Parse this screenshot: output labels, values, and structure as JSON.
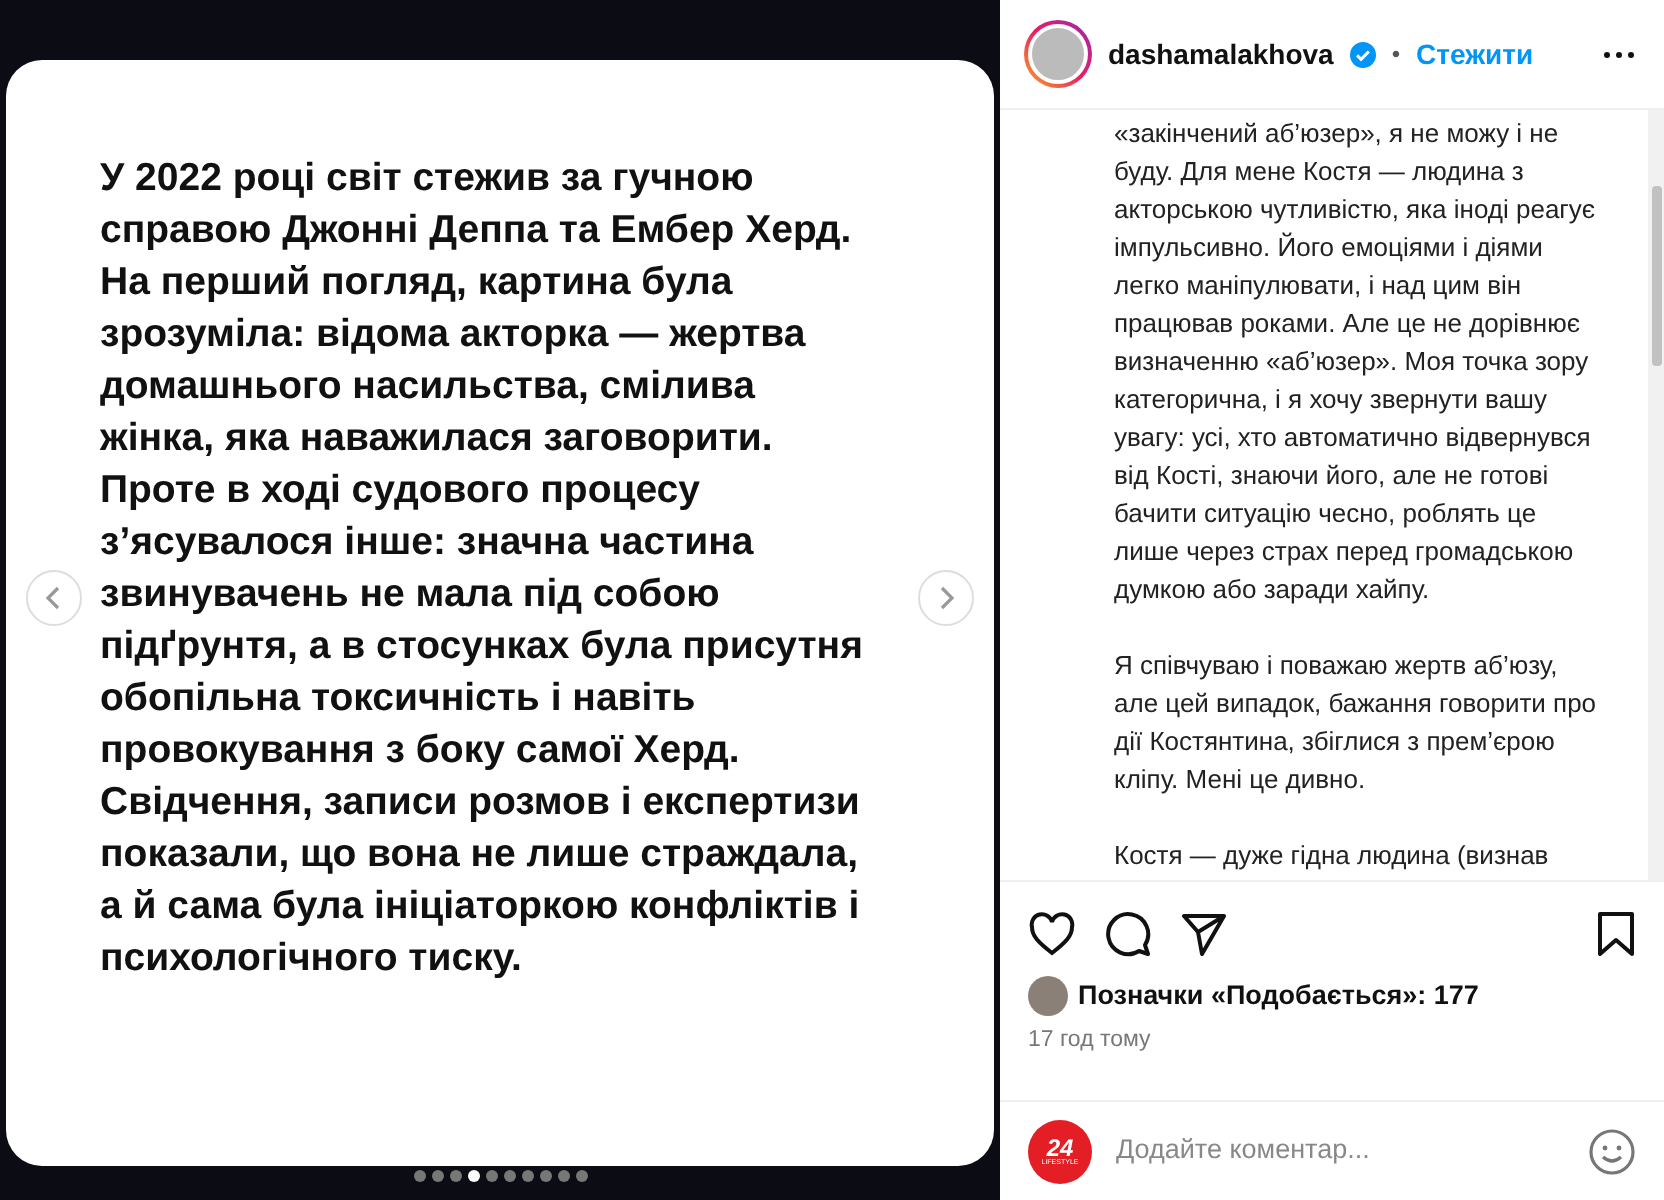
{
  "slide": {
    "text": "У 2022 році світ стежив за гучною справою Джонні Деппа та Ембер Херд. На перший погляд, картина була зрозуміла: відома акторка — жертва домашнього насильства, смілива жінка, яка наважилася заговорити. Проте в ході судового процесу з’ясувалося інше: значна частина звинувачень не мала під собою підґрунтя, а в стосунках була присутня обопільна токсичність і навіть провокування з боку самої Херд. Свідчення, записи розмов і експертизи показали, що вона не лише страждала, а й сама була ініціаторкою конфліктів і психологічного тиску."
  },
  "dots": [
    {
      "selected": false
    },
    {
      "selected": false
    },
    {
      "selected": false
    },
    {
      "selected": true
    },
    {
      "selected": false
    },
    {
      "selected": false
    },
    {
      "selected": false
    },
    {
      "selected": false
    },
    {
      "selected": false
    },
    {
      "selected": false
    }
  ],
  "header": {
    "username": "dashamalakhova",
    "verified": true,
    "separator": "•",
    "follow": "Стежити"
  },
  "caption": [
    "«закінчений аб’юзер», я не можу і не буду. Для мене Костя — людина з акторською чутливістю, яка іноді реагує імпульсивно. Його емоціями і діями легко маніпулювати, і над цим він працював роками. Але це не дорівнює визначенню «аб’юзер». Моя точка зору категорична, і я хочу звернути вашу увагу: усі, хто автоматично відвернувся від Кості, знаючи його, але не готові бачити ситуацію чесно, роблять це лише через страх перед громадською думкою або заради хайпу.",
    "Я співчуваю і поважаю жертв аб’юзу, але цей випадок, бажання говорити про дії Костянтина, збіглися з прем’єрою кліпу. Мені це дивно.",
    "Костя — дуже гідна людина (визнав"
  ],
  "likes": "Позначки «Подобається»: 177",
  "time": "17 год тому",
  "comment": {
    "avatar_text": "24",
    "avatar_subtext": "LIFESTYLE",
    "placeholder": "Додайте коментар..."
  }
}
